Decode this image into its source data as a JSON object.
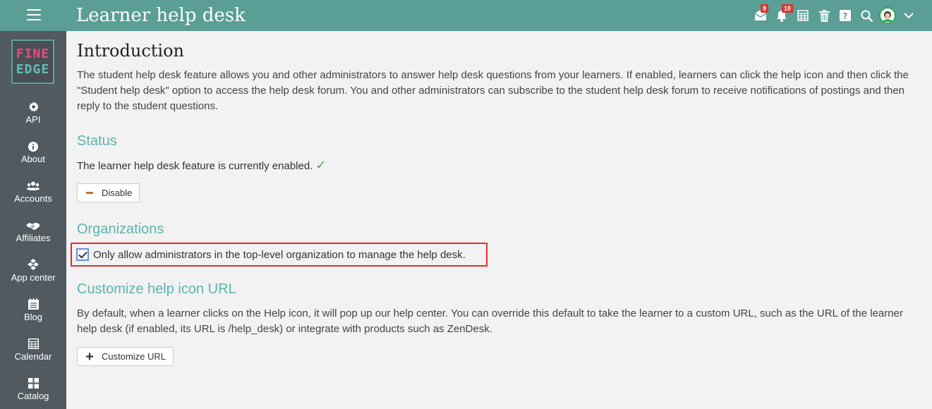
{
  "header": {
    "title": "Learner help desk",
    "icons": [
      {
        "name": "mail-icon",
        "badge": "9"
      },
      {
        "name": "bell-icon",
        "badge": "10"
      },
      {
        "name": "calendar-grid-icon",
        "badge": ""
      },
      {
        "name": "trash-icon",
        "badge": ""
      },
      {
        "name": "help-icon",
        "badge": ""
      },
      {
        "name": "search-icon",
        "badge": ""
      },
      {
        "name": "avatar",
        "badge": ""
      },
      {
        "name": "chevron-down-icon",
        "badge": ""
      }
    ]
  },
  "logo": {
    "line1": "FINE",
    "line2": "EDGE"
  },
  "sidebar": {
    "items": [
      {
        "label": "API",
        "icon": "gear-icon"
      },
      {
        "label": "About",
        "icon": "info-icon"
      },
      {
        "label": "Accounts",
        "icon": "users-icon"
      },
      {
        "label": "Affiliates",
        "icon": "handshake-icon"
      },
      {
        "label": "App center",
        "icon": "cubes-icon"
      },
      {
        "label": "Blog",
        "icon": "blog-icon"
      },
      {
        "label": "Calendar",
        "icon": "calendar-icon"
      },
      {
        "label": "Catalog",
        "icon": "grid-icon"
      }
    ]
  },
  "intro": {
    "heading": "Introduction",
    "text": "The student help desk feature allows you and other administrators to answer help desk questions from your learners. If enabled, learners can click the help icon and then click the \"Student help desk\" option to access the help desk forum. You and other administrators can subscribe to the student help desk forum to receive notifications of postings and then reply to the student questions."
  },
  "status": {
    "heading": "Status",
    "text": "The learner help desk feature is currently enabled.",
    "check": "✓",
    "button_label": "Disable"
  },
  "organizations": {
    "heading": "Organizations",
    "checkbox_checked": true,
    "checkbox_label": "Only allow administrators in the top-level organization to manage the help desk."
  },
  "customize": {
    "heading": "Customize help icon URL",
    "text": "By default, when a learner clicks on the Help icon, it will pop up our help center. You can override this default to take the learner to a custom URL, such as the URL of the learner help desk (if enabled, its URL is /help_desk) or integrate with products such as ZenDesk.",
    "button_label": "Customize URL"
  },
  "colors": {
    "topbar": "#5a9e96",
    "sidebar": "#505a60",
    "accent_heading": "#5ab5ac",
    "highlight_border": "#e52b2b",
    "badge": "#d9342b"
  }
}
